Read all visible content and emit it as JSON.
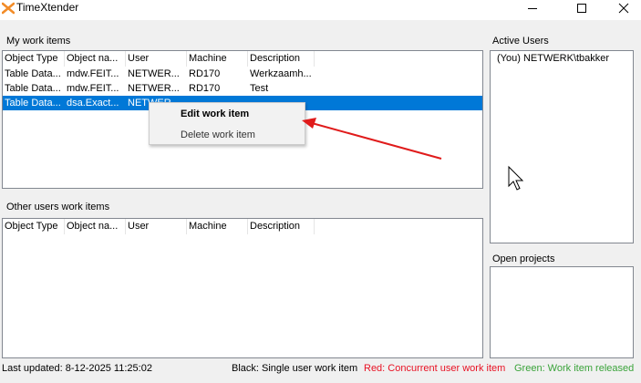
{
  "window": {
    "title": "TimeXtender",
    "accent_color": "#f28c28"
  },
  "my_work_items": {
    "label": "My work items",
    "columns": [
      "Object Type",
      "Object na...",
      "User",
      "Machine",
      "Description"
    ],
    "rows": [
      {
        "object_type": "Table Data...",
        "object_name": "mdw.FEIT...",
        "user": "NETWER...",
        "machine": "RD170",
        "description": "Werkzaamh...",
        "selected": false
      },
      {
        "object_type": "Table Data...",
        "object_name": "mdw.FEIT...",
        "user": "NETWER...",
        "machine": "RD170",
        "description": "Test",
        "selected": false
      },
      {
        "object_type": "Table Data...",
        "object_name": "dsa.Exact...",
        "user": "NETWER...",
        "machine": "",
        "description": "",
        "selected": true
      }
    ],
    "selection_color": "#0078d7"
  },
  "context_menu": {
    "edit_label": "Edit work item",
    "delete_label": "Delete work item"
  },
  "other_users_work_items": {
    "label": "Other users work items",
    "columns": [
      "Object Type",
      "Object na...",
      "User",
      "Machine",
      "Description"
    ]
  },
  "active_users": {
    "label": "Active Users",
    "items": [
      "(You) NETWERK\\tbakker"
    ]
  },
  "open_projects": {
    "label": "Open projects"
  },
  "status_bar": {
    "last_updated": "Last updated: 8-12-2025 11:25:02",
    "legend_black": "Black: Single user work item",
    "legend_red": "Red:  Concurrent user work item",
    "legend_green": "Green: Work item released",
    "black_color": "#000000",
    "red_color": "#e81123",
    "green_color": "#3aa33a"
  },
  "annotation": {
    "arrow_color": "#e01b1b"
  }
}
